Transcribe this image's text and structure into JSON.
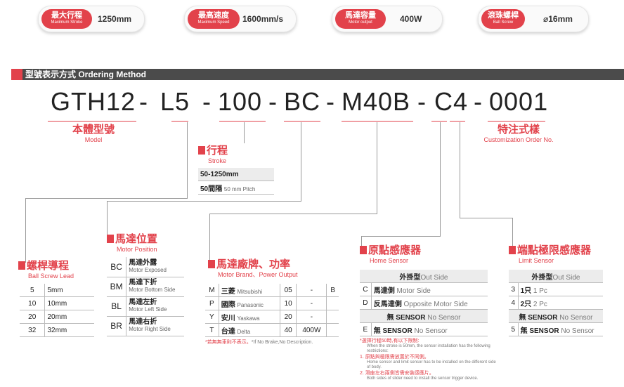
{
  "specs": [
    {
      "zh": "最大行程",
      "en": "Maximum Stroke",
      "value": "1250mm"
    },
    {
      "zh": "最高速度",
      "en": "Maximum Speed",
      "value": "1600mm/s"
    },
    {
      "zh": "馬達容量",
      "en": "Motor output",
      "value": "400W"
    },
    {
      "zh": "滾珠螺桿",
      "en": "Ball Screw",
      "value": "⌀16mm"
    }
  ],
  "section": {
    "title": "型號表示方式 Ordering Method"
  },
  "code": {
    "model": "GTH12",
    "d1": "-",
    "lead": "L5",
    "d2": "-",
    "stroke": "100",
    "d3": "-",
    "brand": "BC",
    "d4": "-",
    "motor": "M40B",
    "d5": "-",
    "sensor": "C4",
    "d6": "-",
    "custom": "0001"
  },
  "model_label": {
    "zh": "本體型號",
    "en": "Model"
  },
  "custom_label": {
    "zh": "特注式樣",
    "en": "Customization Order No."
  },
  "stroke_label": {
    "zh": "行程",
    "en": "Stroke",
    "range": "50-1250mm",
    "step": "50間隔",
    "step_en": "50 mm Pitch"
  },
  "lead_label": {
    "zh": "螺桿導程",
    "en": "Ball Screw Lead",
    "rows": [
      {
        "k": "5",
        "v": "5mm"
      },
      {
        "k": "10",
        "v": "10mm"
      },
      {
        "k": "20",
        "v": "20mm"
      },
      {
        "k": "32",
        "v": "32mm"
      }
    ]
  },
  "motor_pos": {
    "zh": "馬達位置",
    "en": "Motor Position",
    "rows": [
      {
        "k": "BC",
        "zh": "馬達外露",
        "en": "Motor Exposed"
      },
      {
        "k": "BM",
        "zh": "馬達下折",
        "en": "Motor Bottom Side"
      },
      {
        "k": "BL",
        "zh": "馬達左折",
        "en": "Motor Left Side"
      },
      {
        "k": "BR",
        "zh": "馬達右折",
        "en": "Motor Right Side"
      }
    ]
  },
  "brand": {
    "zh": "馬達廠牌、功率",
    "en": "Motor Brand、Power Output",
    "rows": [
      {
        "k": "M",
        "zh": "三菱",
        "en": "Mitsubishi",
        "n": "05",
        "d": "-",
        "b": "B"
      },
      {
        "k": "P",
        "zh": "國際",
        "en": "Panasonic",
        "n": "10",
        "d": "-",
        "b": ""
      },
      {
        "k": "Y",
        "zh": "安川",
        "en": "Yaskawa",
        "n": "20",
        "d": "-",
        "b": ""
      },
      {
        "k": "T",
        "zh": "台達",
        "en": "Delta",
        "n": "40",
        "d": "400W",
        "b": ""
      }
    ],
    "note_zh": "*若無無車則不表示。",
    "note_en": "*If No Brake,No Description."
  },
  "home": {
    "zh": "原點感應器",
    "en": "Home Sensor",
    "head_zh": "外掛型",
    "head_en": "Out Side",
    "rows": [
      {
        "k": "C",
        "zh": "馬達側",
        "en": "Motor Side"
      },
      {
        "k": "D",
        "zh": "反馬達側",
        "en": "Opposite Motor Side"
      },
      {
        "k": "",
        "zh": "無 SENSOR",
        "en": "No Sensor"
      },
      {
        "k": "E",
        "zh": "無 SENSOR",
        "en": "No Sensor"
      }
    ],
    "notes": [
      "*選擇行程50時,有以下限制:",
      "When the stroke is 50mm, the sensor installation has the following restrictions:",
      "1. 原點與極限需放置於不同側。",
      "Home sensor and limit sensor has to be installed on the different side of body.",
      "2. 滑座左右兩側皆需安裝感應片。",
      "Both sides of slider need to install the sensor trigger device."
    ]
  },
  "limit": {
    "zh": "端點極限感應器",
    "en": "Limit Sensor",
    "head_zh": "外掛型",
    "head_en": "Out Side",
    "rows": [
      {
        "k": "3",
        "zh": "1只",
        "en": "1 Pc"
      },
      {
        "k": "4",
        "zh": "2只",
        "en": "2 Pc"
      },
      {
        "k": "",
        "zh": "無 SENSOR",
        "en": "No Sensor"
      },
      {
        "k": "5",
        "zh": "無 SENSOR",
        "en": "No Sensor"
      }
    ]
  }
}
